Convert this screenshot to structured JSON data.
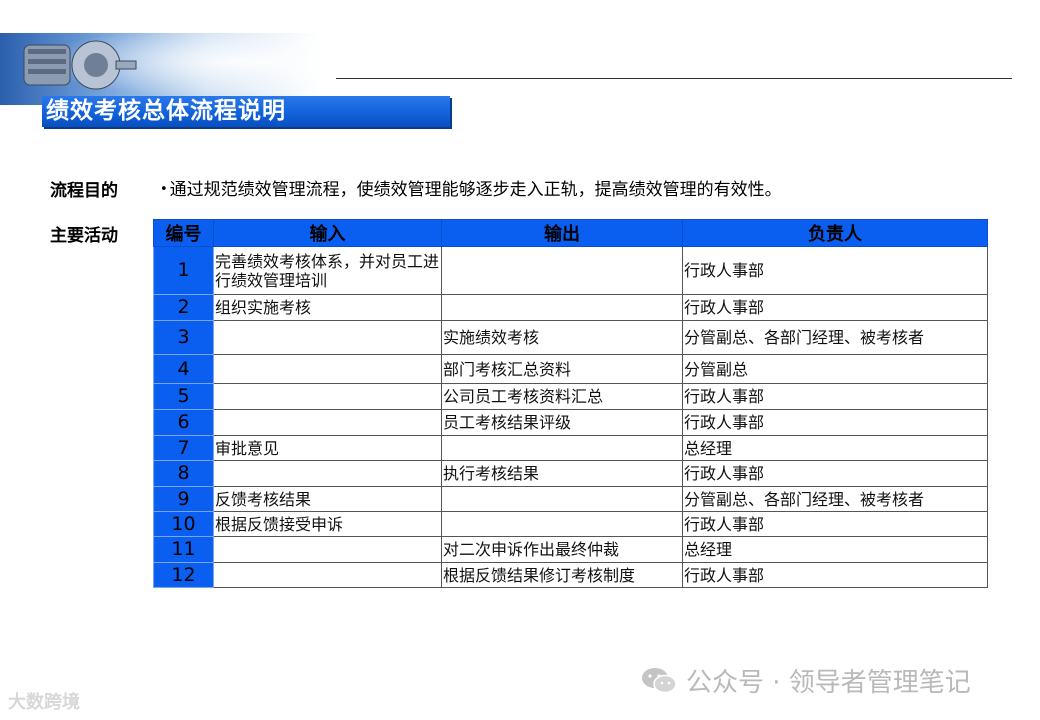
{
  "title": "绩效考核总体流程说明",
  "purpose": {
    "label": "流程目的",
    "bullet": "•",
    "text": "通过规范绩效管理流程，使绩效管理能够逐步走入正轨，提高绩效管理的有效性。"
  },
  "activities": {
    "label": "主要活动",
    "headers": [
      "编号",
      "输入",
      "输出",
      "负责人"
    ],
    "rows": [
      {
        "no": "1",
        "input": "完善绩效考核体系，并对员工进行绩效管理培训",
        "output": "",
        "owner": "行政人事部"
      },
      {
        "no": "2",
        "input": "组织实施考核",
        "output": "",
        "owner": "行政人事部"
      },
      {
        "no": "3",
        "input": "",
        "output": "实施绩效考核",
        "owner": "分管副总、各部门经理、被考核者"
      },
      {
        "no": "4",
        "input": "",
        "output": "部门考核汇总资料",
        "owner": "分管副总"
      },
      {
        "no": "5",
        "input": "",
        "output": "公司员工考核资料汇总",
        "owner": "行政人事部"
      },
      {
        "no": "6",
        "input": "",
        "output": "员工考核结果评级",
        "owner": "行政人事部"
      },
      {
        "no": "7",
        "input": "审批意见",
        "output": "",
        "owner": "总经理"
      },
      {
        "no": "8",
        "input": "",
        "output": "执行考核结果",
        "owner": "行政人事部"
      },
      {
        "no": "9",
        "input": "反馈考核结果",
        "output": "",
        "owner": "分管副总、各部门经理、被考核者"
      },
      {
        "no": "10",
        "input": "根据反馈接受申诉",
        "output": "",
        "owner": "行政人事部"
      },
      {
        "no": "11",
        "input": "",
        "output": "对二次申诉作出最终仲裁",
        "owner": "总经理"
      },
      {
        "no": "12",
        "input": "",
        "output": "根据反馈结果修订考核制度",
        "owner": "行政人事部"
      }
    ]
  },
  "watermark": {
    "left": "大数跨境",
    "right": "公众号 · 领导者管理笔记"
  },
  "colors": {
    "accent_blue": "#0a5ef0"
  }
}
